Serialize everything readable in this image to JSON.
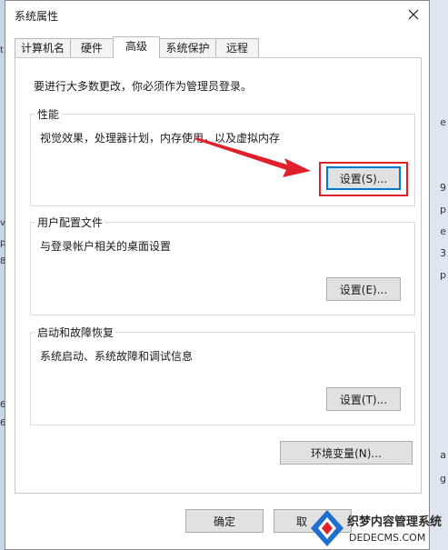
{
  "window": {
    "title": "系统属性"
  },
  "tabs": [
    {
      "label": "计算机名"
    },
    {
      "label": "硬件"
    },
    {
      "label": "高级"
    },
    {
      "label": "系统保护"
    },
    {
      "label": "远程"
    }
  ],
  "panel": {
    "notice": "要进行大多数更改，你必须作为管理员登录。",
    "performance": {
      "label": "性能",
      "description": "视觉效果，处理器计划，内存使用，以及虚拟内存",
      "button": "设置(S)..."
    },
    "user_profiles": {
      "label": "用户配置文件",
      "description": "与登录帐户相关的桌面设置",
      "button": "设置(E)..."
    },
    "startup_recovery": {
      "label": "启动和故障恢复",
      "description": "系统启动、系统故障和调试信息",
      "button": "设置(T)..."
    },
    "env_button": "环境变量(N)..."
  },
  "footer": {
    "ok": "确定",
    "cancel": "取"
  },
  "background": {
    "right_chars": [
      "e",
      "9",
      "p",
      "e",
      "3",
      "p",
      "a",
      "g"
    ],
    "left_chars": [
      "t",
      "v",
      "p",
      "8",
      "6",
      "6"
    ]
  },
  "watermark": {
    "line1": "织梦内容管理系统",
    "line2": "DEDECMS.COM"
  },
  "colors": {
    "accent": "#0078d7",
    "highlight": "#e0202a",
    "button_face": "#e1e1e1"
  }
}
